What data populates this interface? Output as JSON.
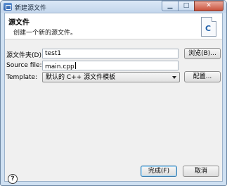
{
  "window": {
    "title": "新建源文件"
  },
  "header": {
    "title": "源文件",
    "description": "创建一个新的源文件。",
    "icon": "c-source-file-icon",
    "icon_letter": "C"
  },
  "form": {
    "source_folder": {
      "label": "源文件夹(D)：",
      "value": "test1",
      "browse_label": "浏览(B)..."
    },
    "source_file": {
      "label": "Source file:",
      "value": "main.cpp"
    },
    "template": {
      "label": "Template:",
      "value": "默认的 C++ 源文件模板",
      "configure_label": "配置..."
    }
  },
  "footer": {
    "help_glyph": "?",
    "finish_label": "完成(F)",
    "cancel_label": "取消"
  },
  "colors": {
    "accent": "#3c7fb1",
    "window_frame": "#cfe0f2",
    "close_button": "#c9513b"
  }
}
